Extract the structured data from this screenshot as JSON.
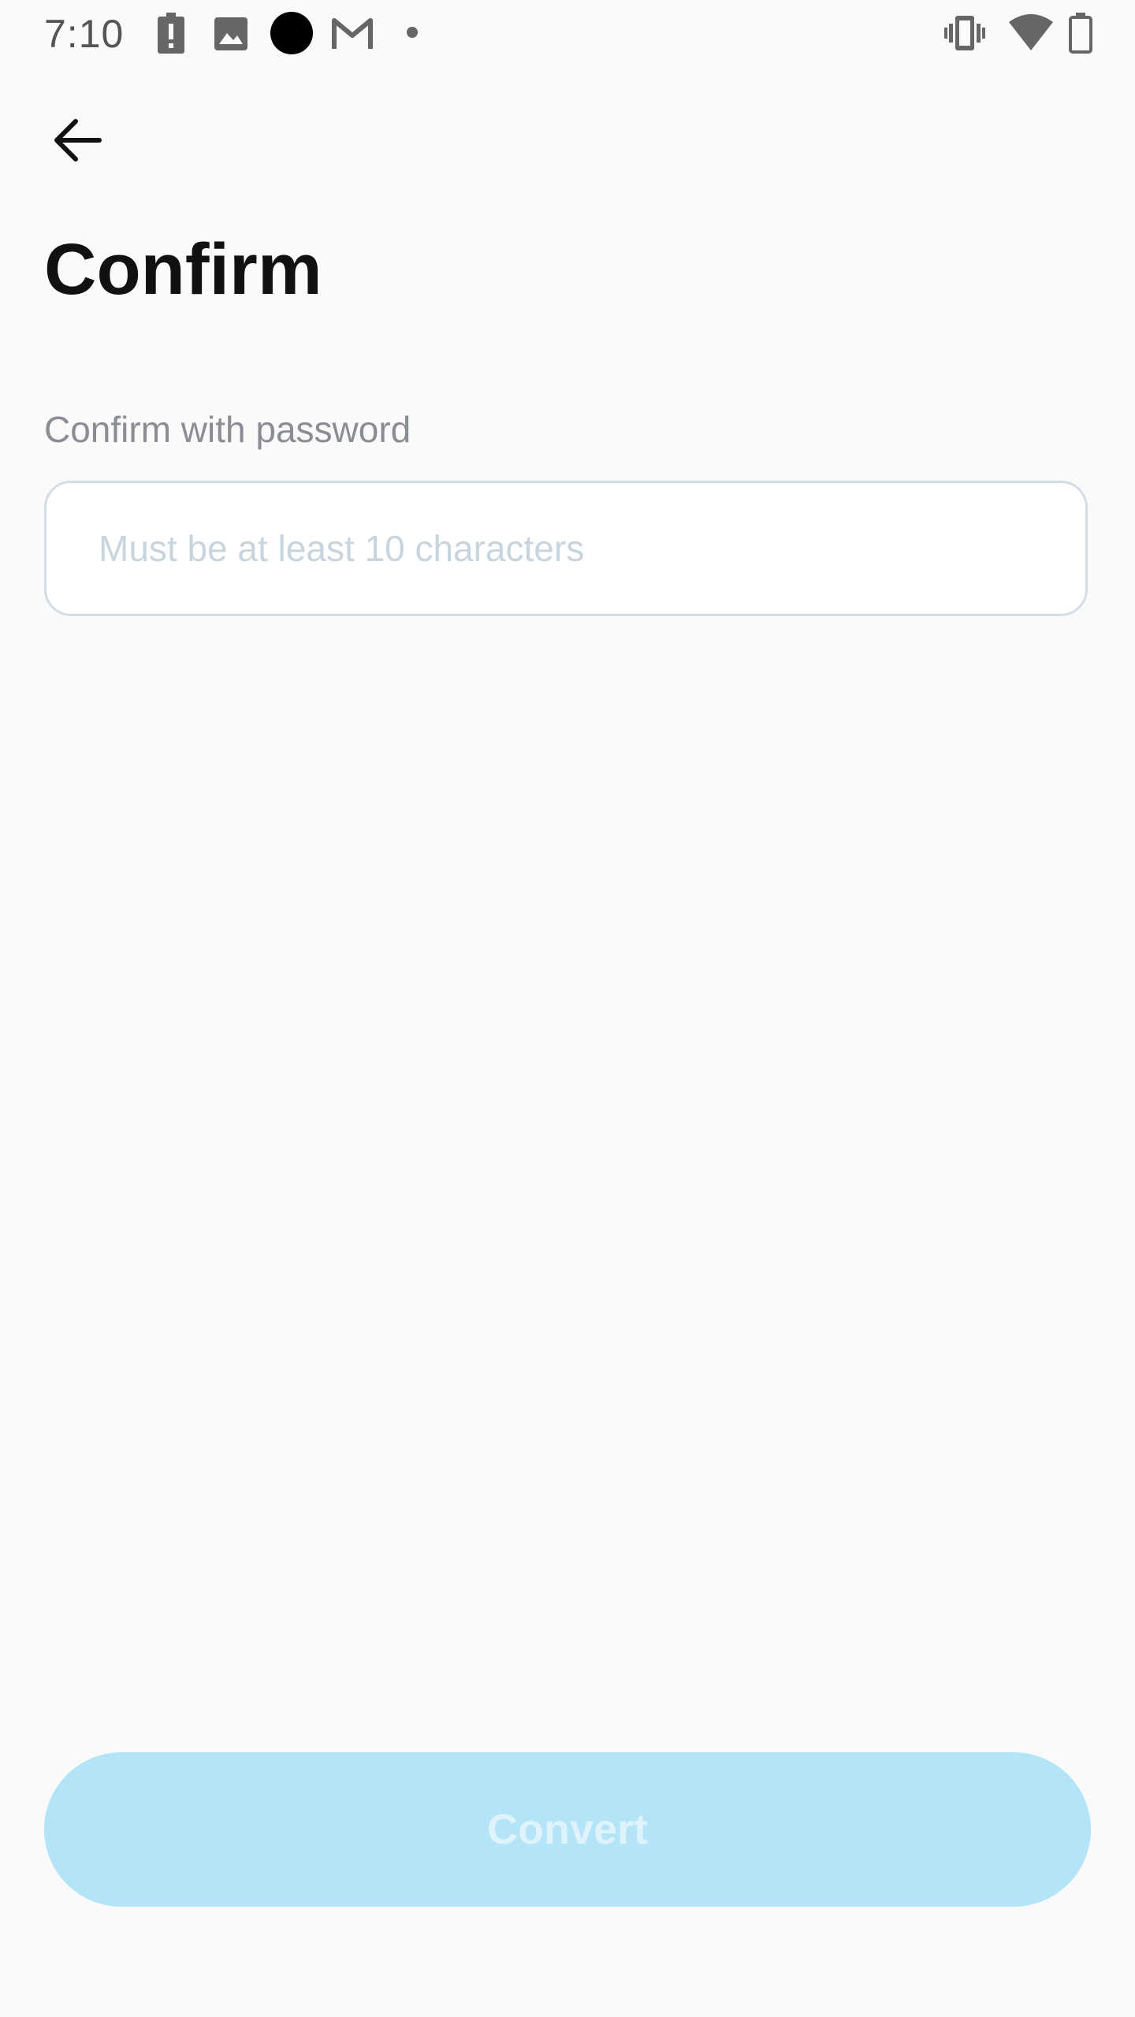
{
  "status_bar": {
    "time": "7:10",
    "icons": [
      "battery-alert-icon",
      "image-icon",
      "circle-icon",
      "gmail-icon",
      "dot-icon",
      "vibrate-icon",
      "wifi-icon",
      "battery-icon"
    ]
  },
  "header": {
    "back_icon": "arrow-left-icon",
    "title": "Confirm"
  },
  "form": {
    "label": "Confirm with password",
    "password_value": "",
    "password_placeholder": "Must be at least 10 characters"
  },
  "actions": {
    "convert_label": "Convert",
    "convert_enabled": false
  },
  "colors": {
    "background": "#fafafa",
    "button_disabled_bg": "#b3e4f8",
    "button_disabled_text": "#dff3fc",
    "input_border": "#d4dde6",
    "placeholder": "#c8d4de",
    "label": "#8a8d94",
    "title": "#111111"
  }
}
